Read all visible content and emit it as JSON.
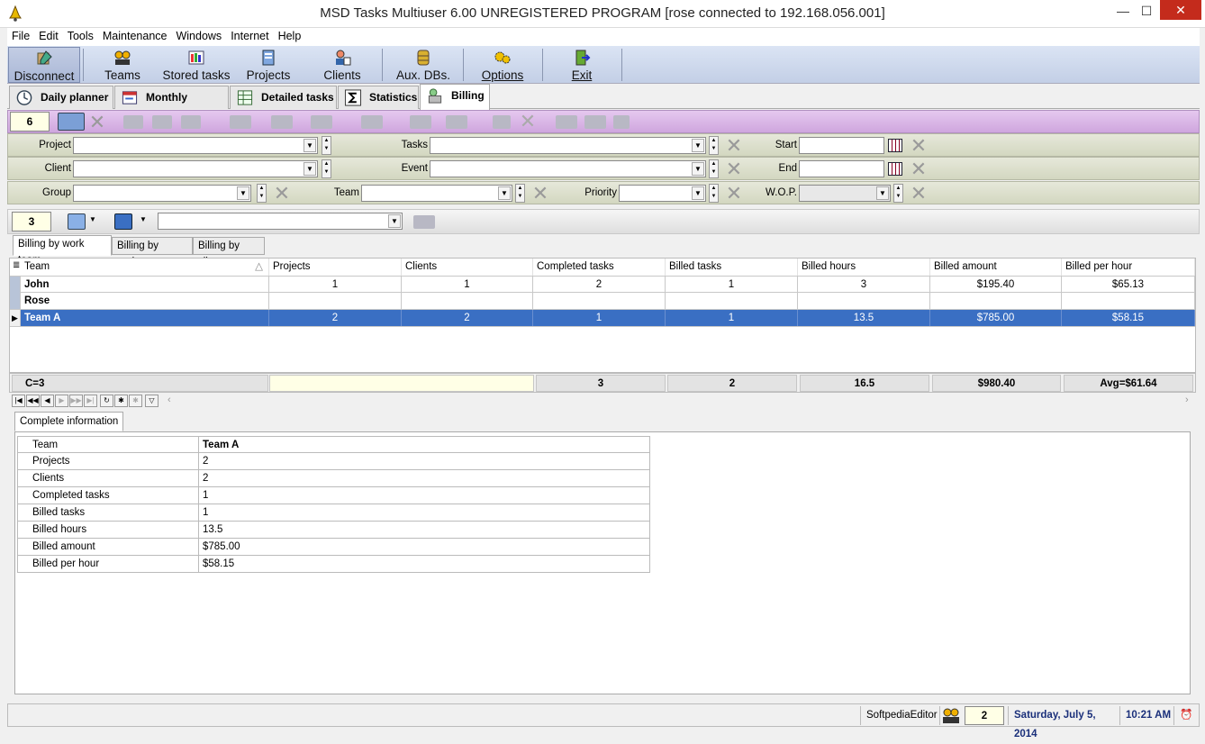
{
  "window": {
    "title": "MSD Tasks Multiuser 6.00 UNREGISTERED PROGRAM [rose connected to 192.168.056.001]",
    "min": "—",
    "max": "☐",
    "close": "✕"
  },
  "menu": [
    "File",
    "Edit",
    "Tools",
    "Maintenance",
    "Windows",
    "Internet",
    "Help"
  ],
  "toolbar": [
    {
      "label": "Disconnect",
      "icon": "disconnect-icon"
    },
    {
      "label": "Teams",
      "icon": "teams-icon"
    },
    {
      "label": "Stored tasks",
      "icon": "stored-tasks-icon"
    },
    {
      "label": "Projects",
      "icon": "projects-icon"
    },
    {
      "label": "Clients",
      "icon": "clients-icon"
    },
    {
      "label": "Aux. DBs.",
      "icon": "database-icon"
    },
    {
      "label": "Options",
      "icon": "options-icon"
    },
    {
      "label": "Exit",
      "icon": "exit-icon"
    }
  ],
  "main_tabs": [
    {
      "label": "Daily planner",
      "icon": "clock-icon"
    },
    {
      "label": "Monthly planner",
      "icon": "calendar-icon"
    },
    {
      "label": "Detailed tasks",
      "icon": "table-icon"
    },
    {
      "label": "Statistics",
      "icon": "sigma-icon"
    },
    {
      "label": "Billing",
      "icon": "billing-icon",
      "active": true
    }
  ],
  "record_count_top": "6",
  "filters": {
    "project_label": "Project",
    "tasks_label": "Tasks",
    "start_label": "Start",
    "client_label": "Client",
    "event_label": "Event",
    "end_label": "End",
    "group_label": "Group",
    "team_label": "Team",
    "priority_label": "Priority",
    "wop_label": "W.O.P."
  },
  "record_count_mid": "3",
  "sub_tabs": [
    "Billing by work team",
    "Billing by project",
    "Billing by client"
  ],
  "grid": {
    "columns": [
      "Team",
      "Projects",
      "Clients",
      "Completed tasks",
      "Billed tasks",
      "Billed hours",
      "Billed amount",
      "Billed per hour"
    ],
    "rows": [
      [
        "John",
        "1",
        "1",
        "2",
        "1",
        "3",
        "$195.40",
        "$65.13"
      ],
      [
        "Rose",
        "",
        "",
        "",
        "",
        "",
        "",
        ""
      ],
      [
        "Team A",
        "2",
        "2",
        "1",
        "1",
        "13.5",
        "$785.00",
        "$58.15"
      ]
    ],
    "selected_row": 2,
    "totals": {
      "count": "C=3",
      "completed": "3",
      "billed_tasks": "2",
      "hours": "16.5",
      "amount": "$980.40",
      "per_hour": "Avg=$61.64"
    }
  },
  "info_tab": "Complete information",
  "info": [
    {
      "key": "Team",
      "value": "Team A"
    },
    {
      "key": "Projects",
      "value": "2"
    },
    {
      "key": "Clients",
      "value": "2"
    },
    {
      "key": "Completed tasks",
      "value": "1"
    },
    {
      "key": "Billed tasks",
      "value": "1"
    },
    {
      "key": "Billed hours",
      "value": "13.5"
    },
    {
      "key": "Billed amount",
      "value": "$785.00"
    },
    {
      "key": "Billed per hour",
      "value": "$58.15"
    }
  ],
  "status": {
    "user": "SoftpediaEditor",
    "count": "2",
    "date": "Saturday, July 5, 2014",
    "time": "10:21 AM"
  }
}
